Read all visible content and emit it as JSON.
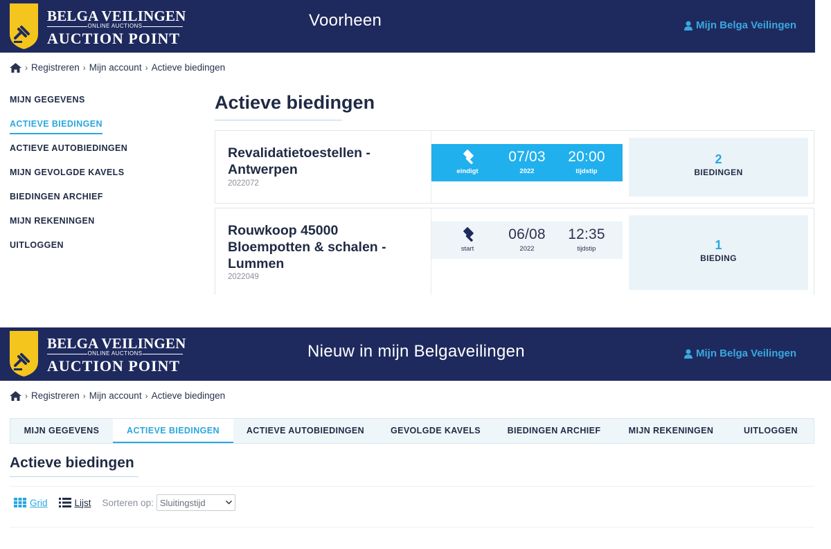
{
  "brand": {
    "line1": "BELGA VEILINGEN",
    "sub": "ONLINE AUCTIONS",
    "line2": "AUCTION POINT"
  },
  "colors": {
    "navy": "#1e2a5e",
    "accent": "#29a7df",
    "timebox_blue": "#20b0ee",
    "shield_yellow": "#f4c51c"
  },
  "old_section": {
    "header_title": "Voorheen",
    "account_link": "Mijn Belga Veilingen",
    "breadcrumb": [
      "Registreren",
      "Mijn account",
      "Actieve biedingen"
    ],
    "sidebar": [
      {
        "label": "MIJN GEGEVENS",
        "active": false
      },
      {
        "label": "ACTIEVE BIEDINGEN",
        "active": true
      },
      {
        "label": "ACTIEVE AUTOBIEDINGEN",
        "active": false
      },
      {
        "label": "MIJN GEVOLGDE KAVELS",
        "active": false
      },
      {
        "label": "BIEDINGEN ARCHIEF",
        "active": false
      },
      {
        "label": "MIJN REKENINGEN",
        "active": false
      },
      {
        "label": "UITLOGGEN",
        "active": false
      }
    ],
    "page_title": "Actieve biedingen",
    "auctions": [
      {
        "name": "Revalidatietoestellen - Antwerpen",
        "code": "2022072",
        "status": "eindigt",
        "date": "07/03",
        "year": "2022",
        "time": "20:00",
        "time_label": "tijdstip",
        "bid_count": "2",
        "bid_label": "BIEDINGEN",
        "style": "blue"
      },
      {
        "name": "Rouwkoop 45000 Bloempotten & schalen - Lummen",
        "code": "2022049",
        "status": "start",
        "date": "06/08",
        "year": "2022",
        "time": "12:35",
        "time_label": "tijdstip",
        "bid_count": "1",
        "bid_label": "BIEDING",
        "style": "light"
      }
    ]
  },
  "new_section": {
    "header_title": "Nieuw in mijn Belgaveilingen",
    "account_link": "Mijn Belga Veilingen",
    "breadcrumb": [
      "Registreren",
      "Mijn account",
      "Actieve biedingen"
    ],
    "tabs": [
      {
        "label": "MIJN GEGEVENS",
        "active": false
      },
      {
        "label": "ACTIEVE BIEDINGEN",
        "active": true
      },
      {
        "label": "ACTIEVE AUTOBIEDINGEN",
        "active": false
      },
      {
        "label": "GEVOLGDE KAVELS",
        "active": false
      },
      {
        "label": "BIEDINGEN ARCHIEF",
        "active": false
      },
      {
        "label": "MIJN REKENINGEN",
        "active": false
      },
      {
        "label": "UITLOGGEN",
        "active": false
      }
    ],
    "page_title": "Actieve biedingen",
    "view_grid": "Grid",
    "view_list": "Lijst",
    "sort_label": "Sorteren op:",
    "sort_value": "Sluitingstijd"
  }
}
